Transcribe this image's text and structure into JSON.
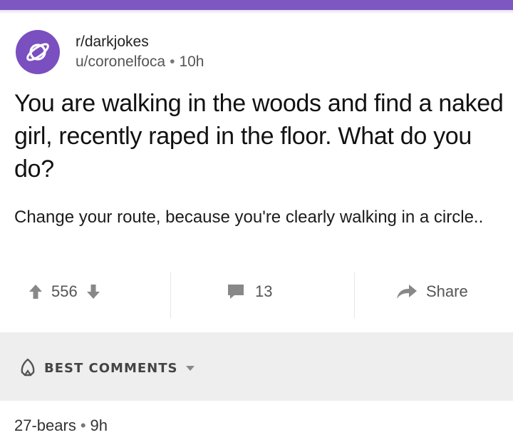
{
  "colors": {
    "accent": "#7e57c2",
    "avatar": "#7a4fbf",
    "sort_bar": "#eeeeee"
  },
  "post": {
    "subreddit": "r/darkjokes",
    "author": "u/coronelfoca",
    "age": "10h",
    "title": "You are walking in the woods and find a naked girl, recently raped in the floor. What do you do?",
    "body": "Change your route, because you're clearly walking in a circle..",
    "avatar_icon": "planet-icon"
  },
  "actions": {
    "score": "556",
    "comment_count": "13",
    "share_label": "Share",
    "icons": [
      "upvote-icon",
      "downvote-icon",
      "comment-icon",
      "share-icon"
    ]
  },
  "comments_section": {
    "sort_label": "BEST COMMENTS",
    "sort_icon": "rocket-icon"
  },
  "first_comment": {
    "author": "27-bears",
    "age": "9h"
  }
}
